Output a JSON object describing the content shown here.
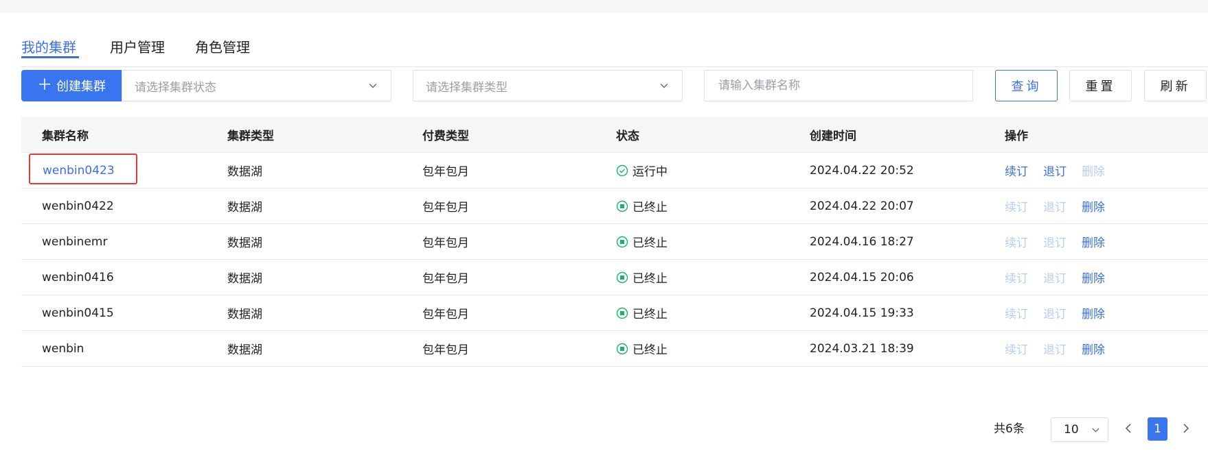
{
  "tabs": [
    {
      "label": "我的集群",
      "active": true
    },
    {
      "label": "用户管理",
      "active": false
    },
    {
      "label": "角色管理",
      "active": false
    }
  ],
  "toolbar": {
    "create_label": "创建集群",
    "status_placeholder": "请选择集群状态",
    "type_placeholder": "请选择集群类型",
    "name_placeholder": "请输入集群名称",
    "query_label": "查询",
    "reset_label": "重置",
    "refresh_label": "刷新"
  },
  "table": {
    "headers": [
      "集群名称",
      "集群类型",
      "付费类型",
      "状态",
      "创建时间",
      "操作"
    ],
    "rows": [
      {
        "name": "wenbin0423",
        "type": "数据湖",
        "billing": "包年包月",
        "status": "运行中",
        "status_kind": "running",
        "created": "2024.04.22 20:52",
        "renew": "续订",
        "unsubscribe": "退订",
        "delete": "删除"
      },
      {
        "name": "wenbin0422",
        "type": "数据湖",
        "billing": "包年包月",
        "status": "已终止",
        "status_kind": "terminated",
        "created": "2024.04.22 20:07",
        "renew": "续订",
        "unsubscribe": "退订",
        "delete": "删除"
      },
      {
        "name": "wenbinemr",
        "type": "数据湖",
        "billing": "包年包月",
        "status": "已终止",
        "status_kind": "terminated",
        "created": "2024.04.16 18:27",
        "renew": "续订",
        "unsubscribe": "退订",
        "delete": "删除"
      },
      {
        "name": "wenbin0416",
        "type": "数据湖",
        "billing": "包年包月",
        "status": "已终止",
        "status_kind": "terminated",
        "created": "2024.04.15 20:06",
        "renew": "续订",
        "unsubscribe": "退订",
        "delete": "删除"
      },
      {
        "name": "wenbin0415",
        "type": "数据湖",
        "billing": "包年包月",
        "status": "已终止",
        "status_kind": "terminated",
        "created": "2024.04.15 19:33",
        "renew": "续订",
        "unsubscribe": "退订",
        "delete": "删除"
      },
      {
        "name": "wenbin",
        "type": "数据湖",
        "billing": "包年包月",
        "status": "已终止",
        "status_kind": "terminated",
        "created": "2024.03.21 18:39",
        "renew": "续订",
        "unsubscribe": "退订",
        "delete": "删除"
      }
    ]
  },
  "pagination": {
    "total_label": "共6条",
    "page_size": "10",
    "current_page": "1"
  },
  "colors": {
    "primary": "#3a75f0",
    "link": "#3a6fe6",
    "disabled_link": "#b7cdf3",
    "status_green": "#19b26b",
    "highlight_red": "#e53935"
  },
  "icons": {
    "create": "plus-icon",
    "select": "chevron-down-icon",
    "running": "check-circle-icon",
    "terminated": "stop-circle-icon",
    "prev": "chevron-left-icon",
    "next": "chevron-right-icon"
  }
}
